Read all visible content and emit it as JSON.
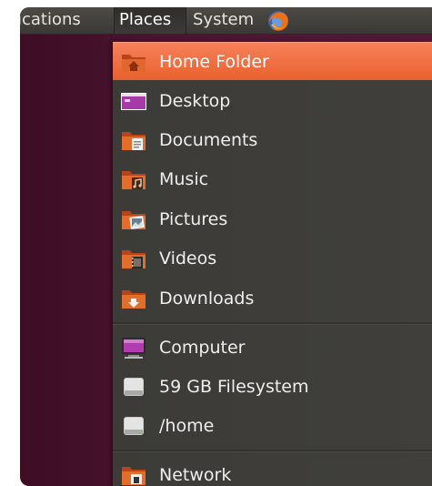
{
  "panel": {
    "menus": [
      "lications",
      "Places",
      "System"
    ],
    "browser_icon": "firefox-icon"
  },
  "places_menu": {
    "items": [
      {
        "label": "Home Folder",
        "icon": "home-folder-icon"
      },
      {
        "label": "Desktop",
        "icon": "desktop-icon"
      },
      {
        "label": "Documents",
        "icon": "documents-folder-icon"
      },
      {
        "label": "Music",
        "icon": "music-folder-icon"
      },
      {
        "label": "Pictures",
        "icon": "pictures-folder-icon"
      },
      {
        "label": "Videos",
        "icon": "videos-folder-icon"
      },
      {
        "label": "Downloads",
        "icon": "downloads-folder-icon"
      },
      {
        "label": "Computer",
        "icon": "computer-icon"
      },
      {
        "label": "59 GB Filesystem",
        "icon": "drive-icon"
      },
      {
        "label": "/home",
        "icon": "drive-icon"
      },
      {
        "label": "Network",
        "icon": "network-folder-icon"
      }
    ],
    "highlighted_item": "Home Folder"
  },
  "colors": {
    "highlight": "#e8612e",
    "menu_background": "#3c3b37",
    "panel_background": "#3f3e3a",
    "desktop_background": "#4a1430",
    "folder_orange": "#e36d2b"
  }
}
